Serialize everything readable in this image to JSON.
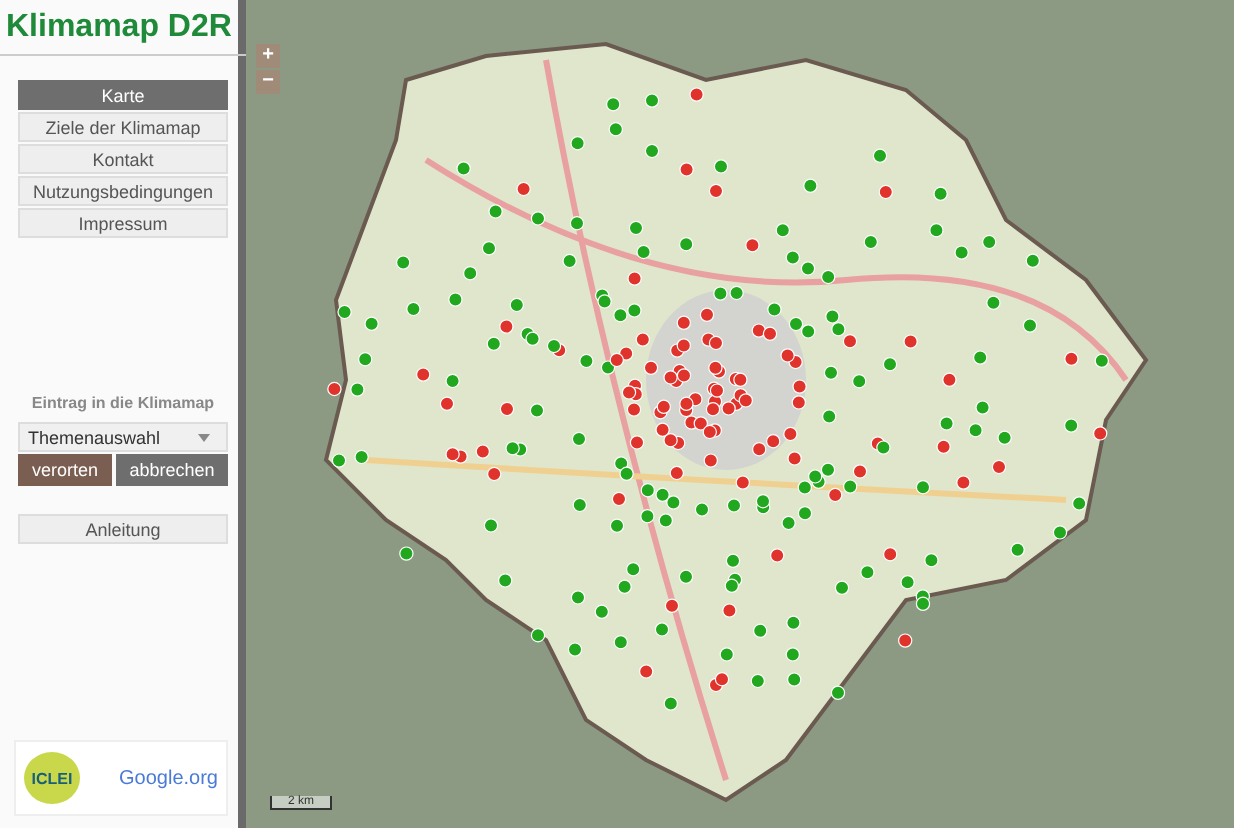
{
  "title": "Klimamap D2R",
  "menu": [
    {
      "label": "Karte",
      "selected": true
    },
    {
      "label": "Ziele der Klimamap",
      "selected": false
    },
    {
      "label": "Kontakt",
      "selected": false
    },
    {
      "label": "Nutzungsbedingungen",
      "selected": false
    },
    {
      "label": "Impressum",
      "selected": false
    }
  ],
  "entry": {
    "heading": "Eintrag in die Klimamap",
    "select": "Themenauswahl",
    "buttons": [
      {
        "label": "verorten",
        "kind": "primary"
      },
      {
        "label": "abbrechen",
        "kind": "secondary"
      }
    ]
  },
  "guide_button": "Anleitung",
  "logos": {
    "iclei": "ICLEI",
    "google": "Google.org"
  },
  "map": {
    "zoom_in": "+",
    "zoom_out": "−",
    "scale": "2 km"
  }
}
